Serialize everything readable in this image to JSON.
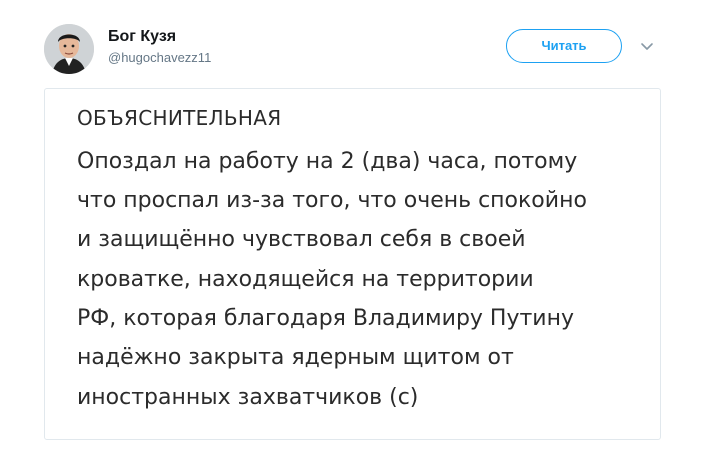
{
  "author": {
    "display_name": "Бог Кузя",
    "handle": "@hugochavezz11",
    "avatar_icon": "user-avatar"
  },
  "actions": {
    "follow_label": "Читать",
    "menu_icon": "chevron-down-icon",
    "accent_color": "#1da1f2"
  },
  "media": {
    "heading": "ОБЪЯСНИТЕЛЬНАЯ",
    "lines": [
      "Опоздал на работу на 2 (два) часа, потому",
      "что проспал из-за того, что очень спокойно",
      "и защищённо чувствовал себя в своей",
      "кроватке, находящейся на территории",
      "РФ, которая благодаря Владимиру Путину",
      "надёжно закрыта ядерным щитом от",
      "иностранных захватчиков (с)"
    ]
  }
}
